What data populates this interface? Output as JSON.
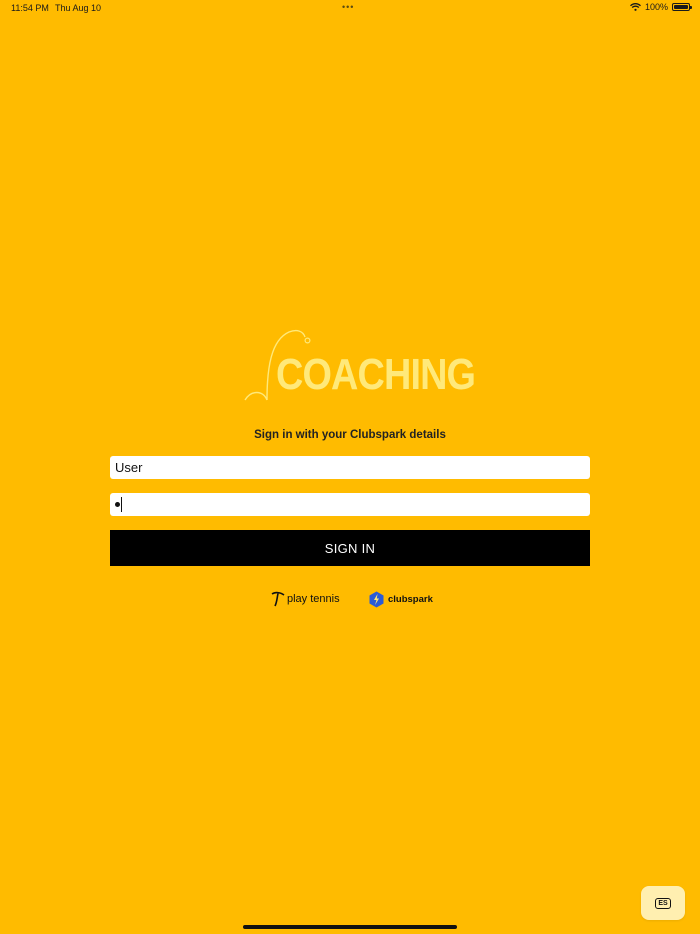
{
  "status_bar": {
    "time": "11:54 PM",
    "date": "Thu Aug 10",
    "multitask_dots": "•••",
    "battery": "100%"
  },
  "app": {
    "logo_text": "COACHING",
    "subtitle": "Sign in with your Clubspark details"
  },
  "form": {
    "username_value": "User",
    "signin_label": "SIGN IN"
  },
  "partners": {
    "playtennis": "play tennis",
    "clubspark": "clubspark"
  },
  "language_button": {
    "label": "ES"
  },
  "colors": {
    "background": "#FFBB00",
    "logo": "#FFE97A",
    "button": "#000000"
  }
}
